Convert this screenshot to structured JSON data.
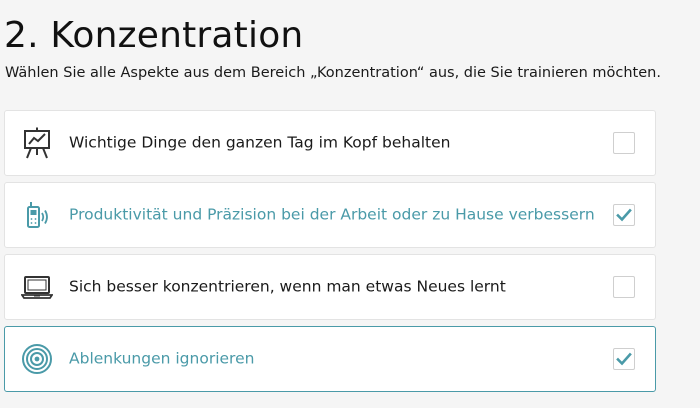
{
  "page": {
    "title": "2. Konzentration",
    "subtitle": "Wählen Sie alle Aspekte aus dem Bereich „Konzentration“ aus, die Sie trainieren möchten."
  },
  "colors": {
    "accent": "#4a9aa8",
    "text": "#1a1a1a",
    "background": "#f5f5f5",
    "card": "#ffffff",
    "border": "#e3e3e3"
  },
  "options": [
    {
      "icon": "presentation-board-icon",
      "label": "Wichtige Dinge den ganzen Tag im Kopf behalten",
      "checked": false
    },
    {
      "icon": "mobile-phone-signal-icon",
      "label": "Produktivität und Präzision bei der Arbeit oder zu Hause verbessern",
      "checked": true
    },
    {
      "icon": "laptop-icon",
      "label": "Sich besser konzentrieren, wenn man etwas Neues lernt",
      "checked": false
    },
    {
      "icon": "target-icon",
      "label": "Ablenkungen ignorieren",
      "checked": true
    }
  ]
}
